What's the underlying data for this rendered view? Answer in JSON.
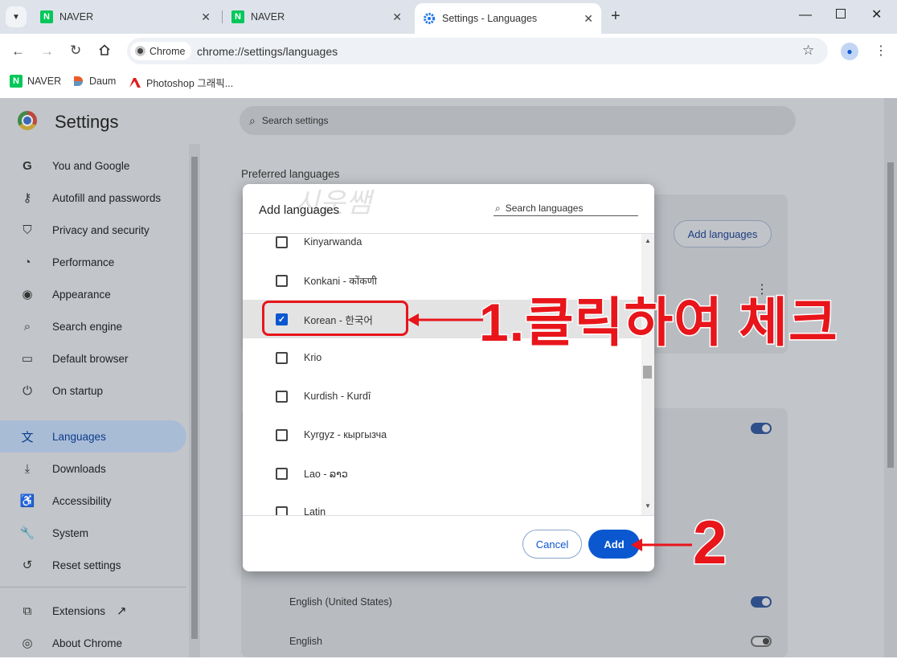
{
  "tabs": [
    {
      "label": "NAVER",
      "favicon": "naver-icon"
    },
    {
      "label": "NAVER",
      "favicon": "naver-icon"
    },
    {
      "label": "Settings - Languages",
      "favicon": "gear-icon"
    }
  ],
  "toolbar": {
    "chip_label": "Chrome",
    "url": "chrome://settings/languages"
  },
  "bookmarks": [
    {
      "label": "NAVER"
    },
    {
      "label": "Daum"
    },
    {
      "label": "Photoshop 그래픽..."
    }
  ],
  "settings": {
    "title": "Settings",
    "search_placeholder": "Search settings",
    "nav": [
      {
        "label": "You and Google",
        "icon": "google-g-icon"
      },
      {
        "label": "Autofill and passwords",
        "icon": "key-icon"
      },
      {
        "label": "Privacy and security",
        "icon": "shield-icon"
      },
      {
        "label": "Performance",
        "icon": "speedometer-icon"
      },
      {
        "label": "Appearance",
        "icon": "palette-icon"
      },
      {
        "label": "Search engine",
        "icon": "search-icon"
      },
      {
        "label": "Default browser",
        "icon": "browser-window-icon"
      },
      {
        "label": "On startup",
        "icon": "power-icon"
      },
      {
        "label": "Languages",
        "icon": "translate-icon"
      },
      {
        "label": "Downloads",
        "icon": "download-icon"
      },
      {
        "label": "Accessibility",
        "icon": "accessibility-icon"
      },
      {
        "label": "System",
        "icon": "wrench-icon"
      },
      {
        "label": "Reset settings",
        "icon": "reset-icon"
      },
      {
        "label": "Extensions",
        "icon": "puzzle-icon"
      },
      {
        "label": "About Chrome",
        "icon": "chrome-icon"
      }
    ],
    "preferred_languages_label": "Preferred languages",
    "add_languages_button": "Add languages",
    "background_rows": [
      {
        "label": "English (United States)",
        "toggle": "on"
      },
      {
        "label": "English",
        "toggle": "off"
      }
    ]
  },
  "dialog": {
    "title": "Add languages",
    "search_placeholder": "Search languages",
    "languages": [
      {
        "label": "Kinyarwanda",
        "checked": false
      },
      {
        "label": "Konkani - कोंकणी",
        "checked": false
      },
      {
        "label": "Korean - 한국어",
        "checked": true
      },
      {
        "label": "Krio",
        "checked": false
      },
      {
        "label": "Kurdish - Kurdî",
        "checked": false
      },
      {
        "label": "Kyrgyz - кыргызча",
        "checked": false
      },
      {
        "label": "Lao - ລາວ",
        "checked": false
      },
      {
        "label": "Latin",
        "checked": false
      }
    ],
    "cancel_label": "Cancel",
    "add_label": "Add"
  },
  "annotations": {
    "step1": "1.클릭하여 체크",
    "step2": "2",
    "watermark": "시운쌤",
    "color": "#e8151b"
  }
}
